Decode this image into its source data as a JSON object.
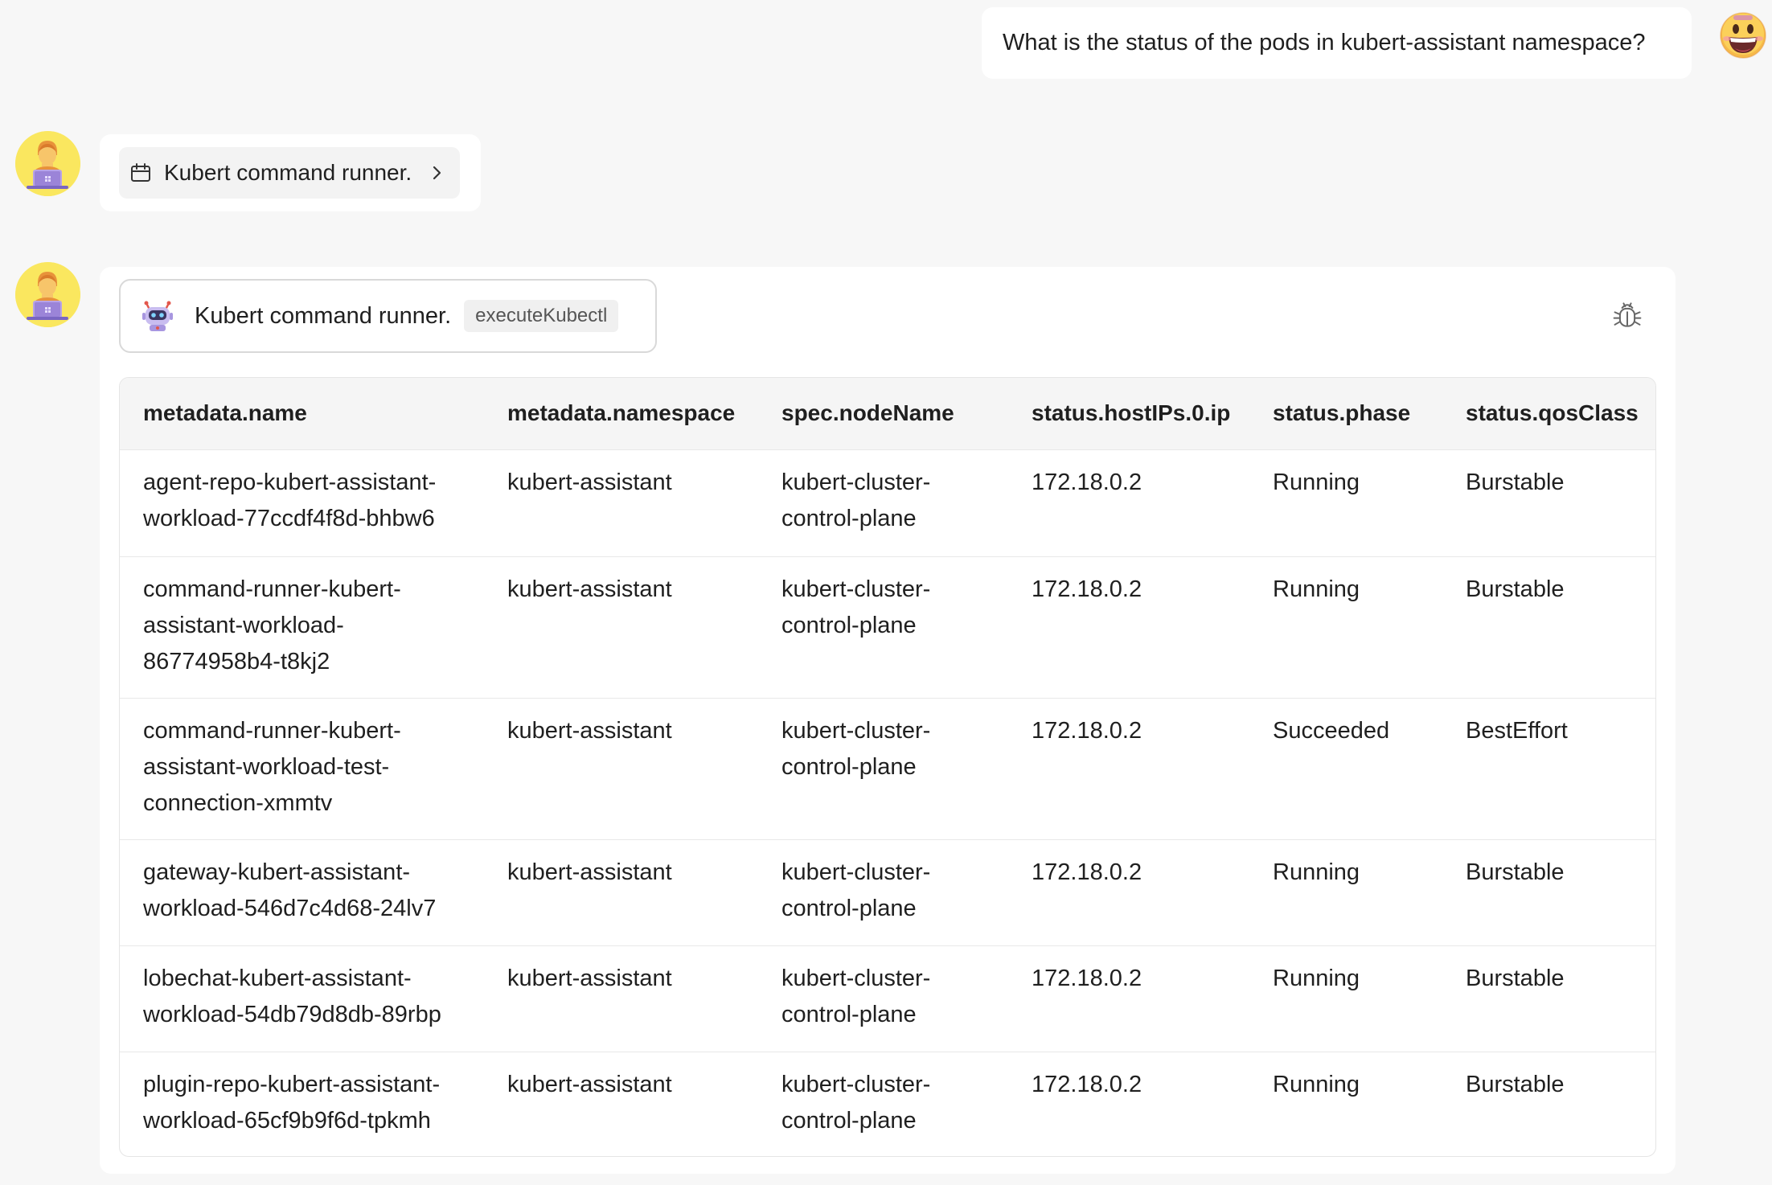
{
  "user_message": {
    "text": "What is the status of the pods in kubert-assistant namespace?"
  },
  "assistant_messages": [
    {
      "tool_call": {
        "label": "Kubert command runner."
      }
    },
    {
      "plugin": {
        "name": "Kubert command runner.",
        "api": "executeKubectl"
      },
      "table": {
        "columns": [
          "metadata.name",
          "metadata.namespace",
          "spec.nodeName",
          "status.hostIPs.0.ip",
          "status.phase",
          "status.qosClass"
        ],
        "rows": [
          [
            "agent-repo-kubert-assistant-workload-77ccdf4f8d-bhbw6",
            "kubert-assistant",
            "kubert-cluster-control-plane",
            "172.18.0.2",
            "Running",
            "Burstable"
          ],
          [
            "command-runner-kubert-assistant-workload-86774958b4-t8kj2",
            "kubert-assistant",
            "kubert-cluster-control-plane",
            "172.18.0.2",
            "Running",
            "Burstable"
          ],
          [
            "command-runner-kubert-assistant-workload-test-connection-xmmtv",
            "kubert-assistant",
            "kubert-cluster-control-plane",
            "172.18.0.2",
            "Succeeded",
            "BestEffort"
          ],
          [
            "gateway-kubert-assistant-workload-546d7c4d68-24lv7",
            "kubert-assistant",
            "kubert-cluster-control-plane",
            "172.18.0.2",
            "Running",
            "Burstable"
          ],
          [
            "lobechat-kubert-assistant-workload-54db79d8db-89rbp",
            "kubert-assistant",
            "kubert-cluster-control-plane",
            "172.18.0.2",
            "Running",
            "Burstable"
          ],
          [
            "plugin-repo-kubert-assistant-workload-65cf9b9f6d-tpkmh",
            "kubert-assistant",
            "kubert-cluster-control-plane",
            "172.18.0.2",
            "Running",
            "Burstable"
          ]
        ]
      }
    }
  ],
  "icons": {
    "user_avatar": "smiling-face-icon",
    "assistant_avatar": "technologist-icon",
    "tool_call": "calendar-icon",
    "expand": "chevron-right-icon",
    "plugin": "robot-icon",
    "debug": "bug-icon"
  },
  "colors": {
    "page_background": "#f7f7f7",
    "bubble_background": "#ffffff",
    "avatar_background": "#fae75f"
  }
}
